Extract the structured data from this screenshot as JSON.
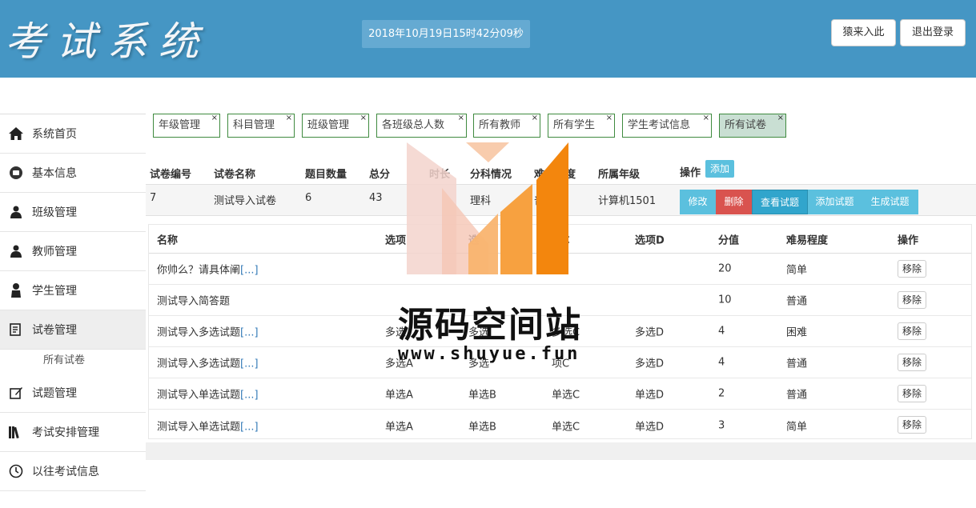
{
  "header": {
    "logo": "考试系统",
    "clock": "2018年10月19日15时42分09秒",
    "user_btn": "猿来入此",
    "logout_btn": "退出登录",
    "bg_color": "#4596c4"
  },
  "sidebar": {
    "items": [
      {
        "label": "系统首页",
        "icon": "home-icon"
      },
      {
        "label": "基本信息",
        "icon": "info-icon"
      },
      {
        "label": "班级管理",
        "icon": "users-icon"
      },
      {
        "label": "教师管理",
        "icon": "users-icon"
      },
      {
        "label": "学生管理",
        "icon": "user-icon"
      },
      {
        "label": "试卷管理",
        "icon": "edit-icon"
      },
      {
        "label": "试题管理",
        "icon": "pen-icon"
      },
      {
        "label": "考试安排管理",
        "icon": "books-icon"
      },
      {
        "label": "以往考试信息",
        "icon": "clock-icon"
      }
    ],
    "sub_item": "所有试卷"
  },
  "tabs": [
    {
      "label": "年级管理",
      "close": "×"
    },
    {
      "label": "科目管理",
      "close": "×"
    },
    {
      "label": "班级管理",
      "close": "×"
    },
    {
      "label": "各班级总人数",
      "close": "×"
    },
    {
      "label": "所有教师",
      "close": "×"
    },
    {
      "label": "所有学生",
      "close": "×"
    },
    {
      "label": "学生考试信息",
      "close": "×"
    },
    {
      "label": "所有试卷",
      "close": "×"
    }
  ],
  "paper_table": {
    "headers": [
      "试卷编号",
      "试卷名称",
      "题目数量",
      "总分",
      "时长",
      "分科情况",
      "难易程度",
      "所属年级",
      "操作"
    ],
    "add_label": "添加",
    "row": {
      "id": "7",
      "name": "测试导入试卷",
      "count": "6",
      "total": "43",
      "duration": "",
      "branch": "理科",
      "difficulty": "普",
      "grade": "计算机1501"
    },
    "actions": {
      "edit": "修改",
      "delete": "删除",
      "view": "查看试题",
      "add_q": "添加试题",
      "gen": "生成试题"
    }
  },
  "question_table": {
    "headers": [
      "名称",
      "选项",
      "选",
      "项C",
      "选项D",
      "分值",
      "难易程度",
      "操作"
    ],
    "rows": [
      {
        "name": "你帅么？请具体阐",
        "more": "[...]",
        "a": "",
        "b": "",
        "c": "",
        "d": "",
        "score": "20",
        "level": "简单"
      },
      {
        "name": "测试导入简答题",
        "more": "",
        "a": "",
        "b": "",
        "c": "",
        "d": "",
        "score": "10",
        "level": "普通"
      },
      {
        "name": "测试导入多选试题",
        "more": "[...]",
        "a": "多选",
        "b": "多选",
        "c": "多选C",
        "d": "多选D",
        "score": "4",
        "level": "困难"
      },
      {
        "name": "测试导入多选试题",
        "more": "[...]",
        "a": "多选A",
        "b": "多选",
        "c": "项C",
        "d": "多选D",
        "score": "4",
        "level": "普通"
      },
      {
        "name": "测试导入单选试题",
        "more": "[...]",
        "a": "单选A",
        "b": "单选B",
        "c": "单选C",
        "d": "单选D",
        "score": "2",
        "level": "普通"
      },
      {
        "name": "测试导入单选试题",
        "more": "[...]",
        "a": "单选A",
        "b": "单选B",
        "c": "单选C",
        "d": "单选D",
        "score": "3",
        "level": "简单"
      }
    ],
    "remove_label": "移除"
  },
  "watermark": {
    "title": "源码空间站",
    "url": "www.shuyue.fun"
  }
}
